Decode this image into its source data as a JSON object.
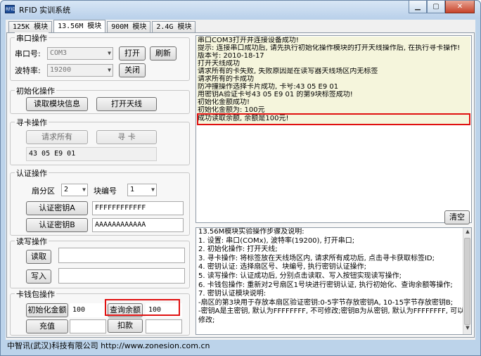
{
  "window": {
    "title": "RFID 实训系统",
    "icon_text": "RFID",
    "min_icon": "minimize-icon",
    "max_icon": "maximize-icon",
    "close_icon": "close-icon"
  },
  "tabs": [
    "125K 模块",
    "13.56M 模块",
    "900M 模块",
    "2.4G 模块"
  ],
  "serial": {
    "legend": "串口操作",
    "port_label": "串口号:",
    "port_value": "COM3",
    "baud_label": "波特率:",
    "baud_value": "19200",
    "open_label": "打开",
    "refresh_label": "刷新",
    "close_label": "关闭"
  },
  "init": {
    "legend": "初始化操作",
    "read_info_label": "读取模块信息",
    "open_antenna_label": "打开天线"
  },
  "search": {
    "legend": "寻卡操作",
    "request_all_label": "请求所有",
    "find_card_label": "寻 卡",
    "card_id": "43 05 E9 01"
  },
  "auth": {
    "legend": "认证操作",
    "sector_label": "扇分区",
    "sector_value": "2",
    "block_label": "块编号",
    "block_value": "1",
    "key_a_label": "认证密钥A",
    "key_a_value": "FFFFFFFFFFFF",
    "key_b_label": "认证密钥B",
    "key_b_value": "AAAAAAAAAAAA"
  },
  "rw": {
    "legend": "读写操作",
    "read_label": "读取",
    "write_label": "写入",
    "read_value": "",
    "write_value": ""
  },
  "wallet": {
    "legend": "卡钱包操作",
    "init_amount_label": "初始化金额",
    "init_amount_value": "100",
    "query_label": "查询余额",
    "query_value": "100",
    "recharge_label": "充值",
    "deduct_label": "扣款",
    "recharge_value": "",
    "deduct_value": ""
  },
  "log": {
    "lines": [
      "串口COM3打开并连接设备成功!",
      "提示: 连接串口成功后, 请先执行初始化操作模块的打开天线操作后, 在执行寻卡操作!",
      "版本号: 2010-18-17",
      "打开天线成功",
      "请求所有的卡失败, 失败原因是在读写器天线场区内无标签",
      "请求所有的卡成功",
      "防冲撞操作选择卡片成功, 卡号:43  05 E9 01",
      "用密钥A验证卡号43 05 E9 01 的第9块标签成功!",
      "初始化金额成功!",
      "初始化金额为: 100元",
      "成功读取余额, 余额是100元!"
    ],
    "clear_label": "清空"
  },
  "steps": {
    "lines": [
      "13.56M模块实验操作步骤及说明:",
      "1. 设置: 串口(COMx), 波特率(19200), 打开串口;",
      "2. 初始化操作: 打开天线;",
      "3. 寻卡操作: 将标签放在天线场区内, 请求所有成功后, 点击寻卡获取标签ID;",
      "4. 密钥认证: 选择扇区号、块编号, 执行密钥认证操作;",
      "5. 读写操作: 认证成功后, 分别点击读取、写入按钮实现读写操作;",
      "6. 卡钱包操作: 重新对2号扇区1号块进行密钥认证, 执行初始化、查询余额等操作;",
      "7. 密钥认证模块说明:",
      "   -扇区的第3块用于存放本扇区验证密钥:0-5字节存放密钥A, 10-15字节存放密钥B;",
      "   -密钥A是主密钥, 默认为FFFFFFFF, 不可修改;密钥B为从密钥, 默认为FFFFFFFF, 可以",
      "修改;"
    ]
  },
  "status": "中智讯(武汉)科技有限公司 http://www.zonesion.com.cn"
}
